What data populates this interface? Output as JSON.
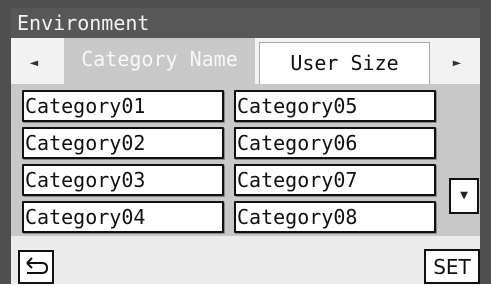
{
  "window": {
    "title": "Environment"
  },
  "tabs": {
    "prev_icon": "◄",
    "next_icon": "►",
    "items": [
      {
        "label": "Category Name",
        "active": true
      },
      {
        "label": "User Size",
        "active": false
      }
    ]
  },
  "categories": [
    "Category01",
    "Category02",
    "Category03",
    "Category04",
    "Category05",
    "Category06",
    "Category07",
    "Category08"
  ],
  "scroll": {
    "down_icon": "▼"
  },
  "footer": {
    "back_icon": "return-arrow-icon",
    "set_label": "SET"
  }
}
